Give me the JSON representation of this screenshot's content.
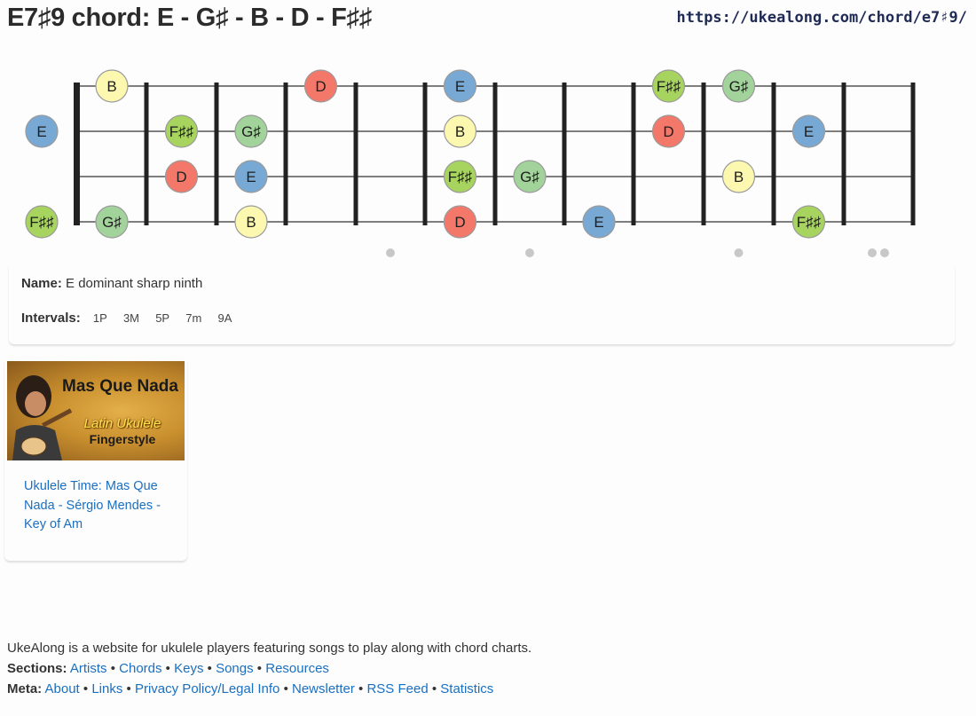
{
  "page": {
    "title": "E7♯9 chord: E - G♯ - B - D - F♯♯",
    "url": "https://ukealong.com/chord/e7♯9/"
  },
  "colors": {
    "E": "#78a9d4",
    "G♯": "#a2d39a",
    "B": "#fdf8b0",
    "D": "#f4786a",
    "F♯♯": "#a6d45e"
  },
  "fretboard": {
    "strings_top_to_bottom": [
      "A",
      "E",
      "C",
      "G"
    ],
    "open_notes": [
      null,
      "E",
      null,
      "F♯♯"
    ],
    "frets": [
      [
        "B",
        null,
        null,
        "G♯"
      ],
      [
        null,
        "F♯♯",
        "D",
        null
      ],
      [
        null,
        "G♯",
        "E",
        "B"
      ],
      [
        "D",
        null,
        null,
        null
      ],
      [
        null,
        null,
        null,
        null
      ],
      [
        "E",
        "B",
        "F♯♯",
        "D"
      ],
      [
        null,
        null,
        "G♯",
        null
      ],
      [
        null,
        null,
        null,
        "E"
      ],
      [
        "F♯♯",
        "D",
        null,
        null
      ],
      [
        "G♯",
        null,
        "B",
        null
      ],
      [
        null,
        "E",
        null,
        "F♯♯"
      ]
    ],
    "position_markers": [
      {
        "fret": 5,
        "count": 1
      },
      {
        "fret": 7,
        "count": 1
      },
      {
        "fret": 10,
        "count": 1
      },
      {
        "fret": 12,
        "count": 2
      }
    ]
  },
  "info": {
    "name_label": "Name:",
    "name_value": "E dominant sharp ninth",
    "intervals_label": "Intervals:",
    "intervals": [
      "1P",
      "3M",
      "5P",
      "7m",
      "9A"
    ]
  },
  "video": {
    "thumb_title": "Mas Que Nada",
    "thumb_subtitle": "Latin Ukulele",
    "thumb_subtitle2": "Fingerstyle",
    "link_text": "Ukulele Time: Mas Que Nada - Sérgio Mendes - Key of Am"
  },
  "footer": {
    "tagline": "UkeAlong is a website for ukulele players featuring songs to play along with chord charts.",
    "sections_label": "Sections:",
    "sections": [
      "Artists",
      "Chords",
      "Keys",
      "Songs",
      "Resources"
    ],
    "meta_label": "Meta:",
    "meta": [
      "About",
      "Links",
      "Privacy Policy/Legal Info",
      "Newsletter",
      "RSS Feed",
      "Statistics"
    ]
  }
}
